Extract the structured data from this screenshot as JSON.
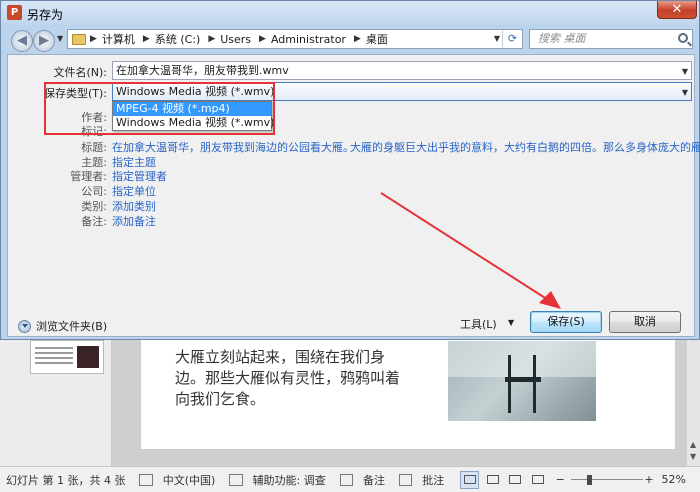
{
  "dialog": {
    "title": "另存为",
    "close_glyph": "✕",
    "address": [
      "计算机",
      "系统 (C:)",
      "Users",
      "Administrator",
      "桌面"
    ],
    "search_placeholder": "搜索 桌面",
    "filename_label": "文件名(N):",
    "filename_value": "在加拿大温哥华，朋友带我到.wmv",
    "filetype_label": "保存类型(T):",
    "filetype_value": "Windows Media 视频 (*.wmv)",
    "filetype_options": [
      "MPEG-4 视频 (*.mp4)",
      "Windows Media 视频 (*.wmv)"
    ],
    "meta": {
      "authors_label": "作者:",
      "tags_label": "标记:",
      "title_label": "标题:",
      "title_value": "在加拿大温哥华，朋友带我到海边的公园看大雁。",
      "subject_label": "主题:",
      "subject_value": "指定主题",
      "manager_label": "管理者:",
      "manager_value": "指定管理者",
      "company_label": "公司:",
      "company_value": "指定单位",
      "category_label": "类别:",
      "category_value": "添加类别",
      "comments_label": "备注:",
      "comments_value": "添加备注",
      "description_value": "大雁的身躯巨大出乎我的意料，大约有白鹅的四倍。那么多身体庞大的雁聚..."
    },
    "browse_folders": "浏览文件夹(B)",
    "tools": "工具(L)",
    "save": "保存(S)",
    "cancel": "取消"
  },
  "slide": {
    "text": "大雁立刻站起来，围绕在我们身边。那些大雁似有灵性，鸦鸦叫着向我们乞食。"
  },
  "statusbar": {
    "slide_info": "幻灯片 第 1 张，共 4 张",
    "language": "中文(中国)",
    "accessibility": "辅助功能: 调查",
    "notes": "备注",
    "comments": "批注",
    "zoom_minus": "−",
    "zoom_plus": "+",
    "zoom": "52%",
    "zoom_level_percent": 52
  },
  "colors": {
    "highlight_box": "#e53238",
    "arrow": "#e53238",
    "link_blue": "#2a64c8",
    "selection": "#3399ff"
  }
}
